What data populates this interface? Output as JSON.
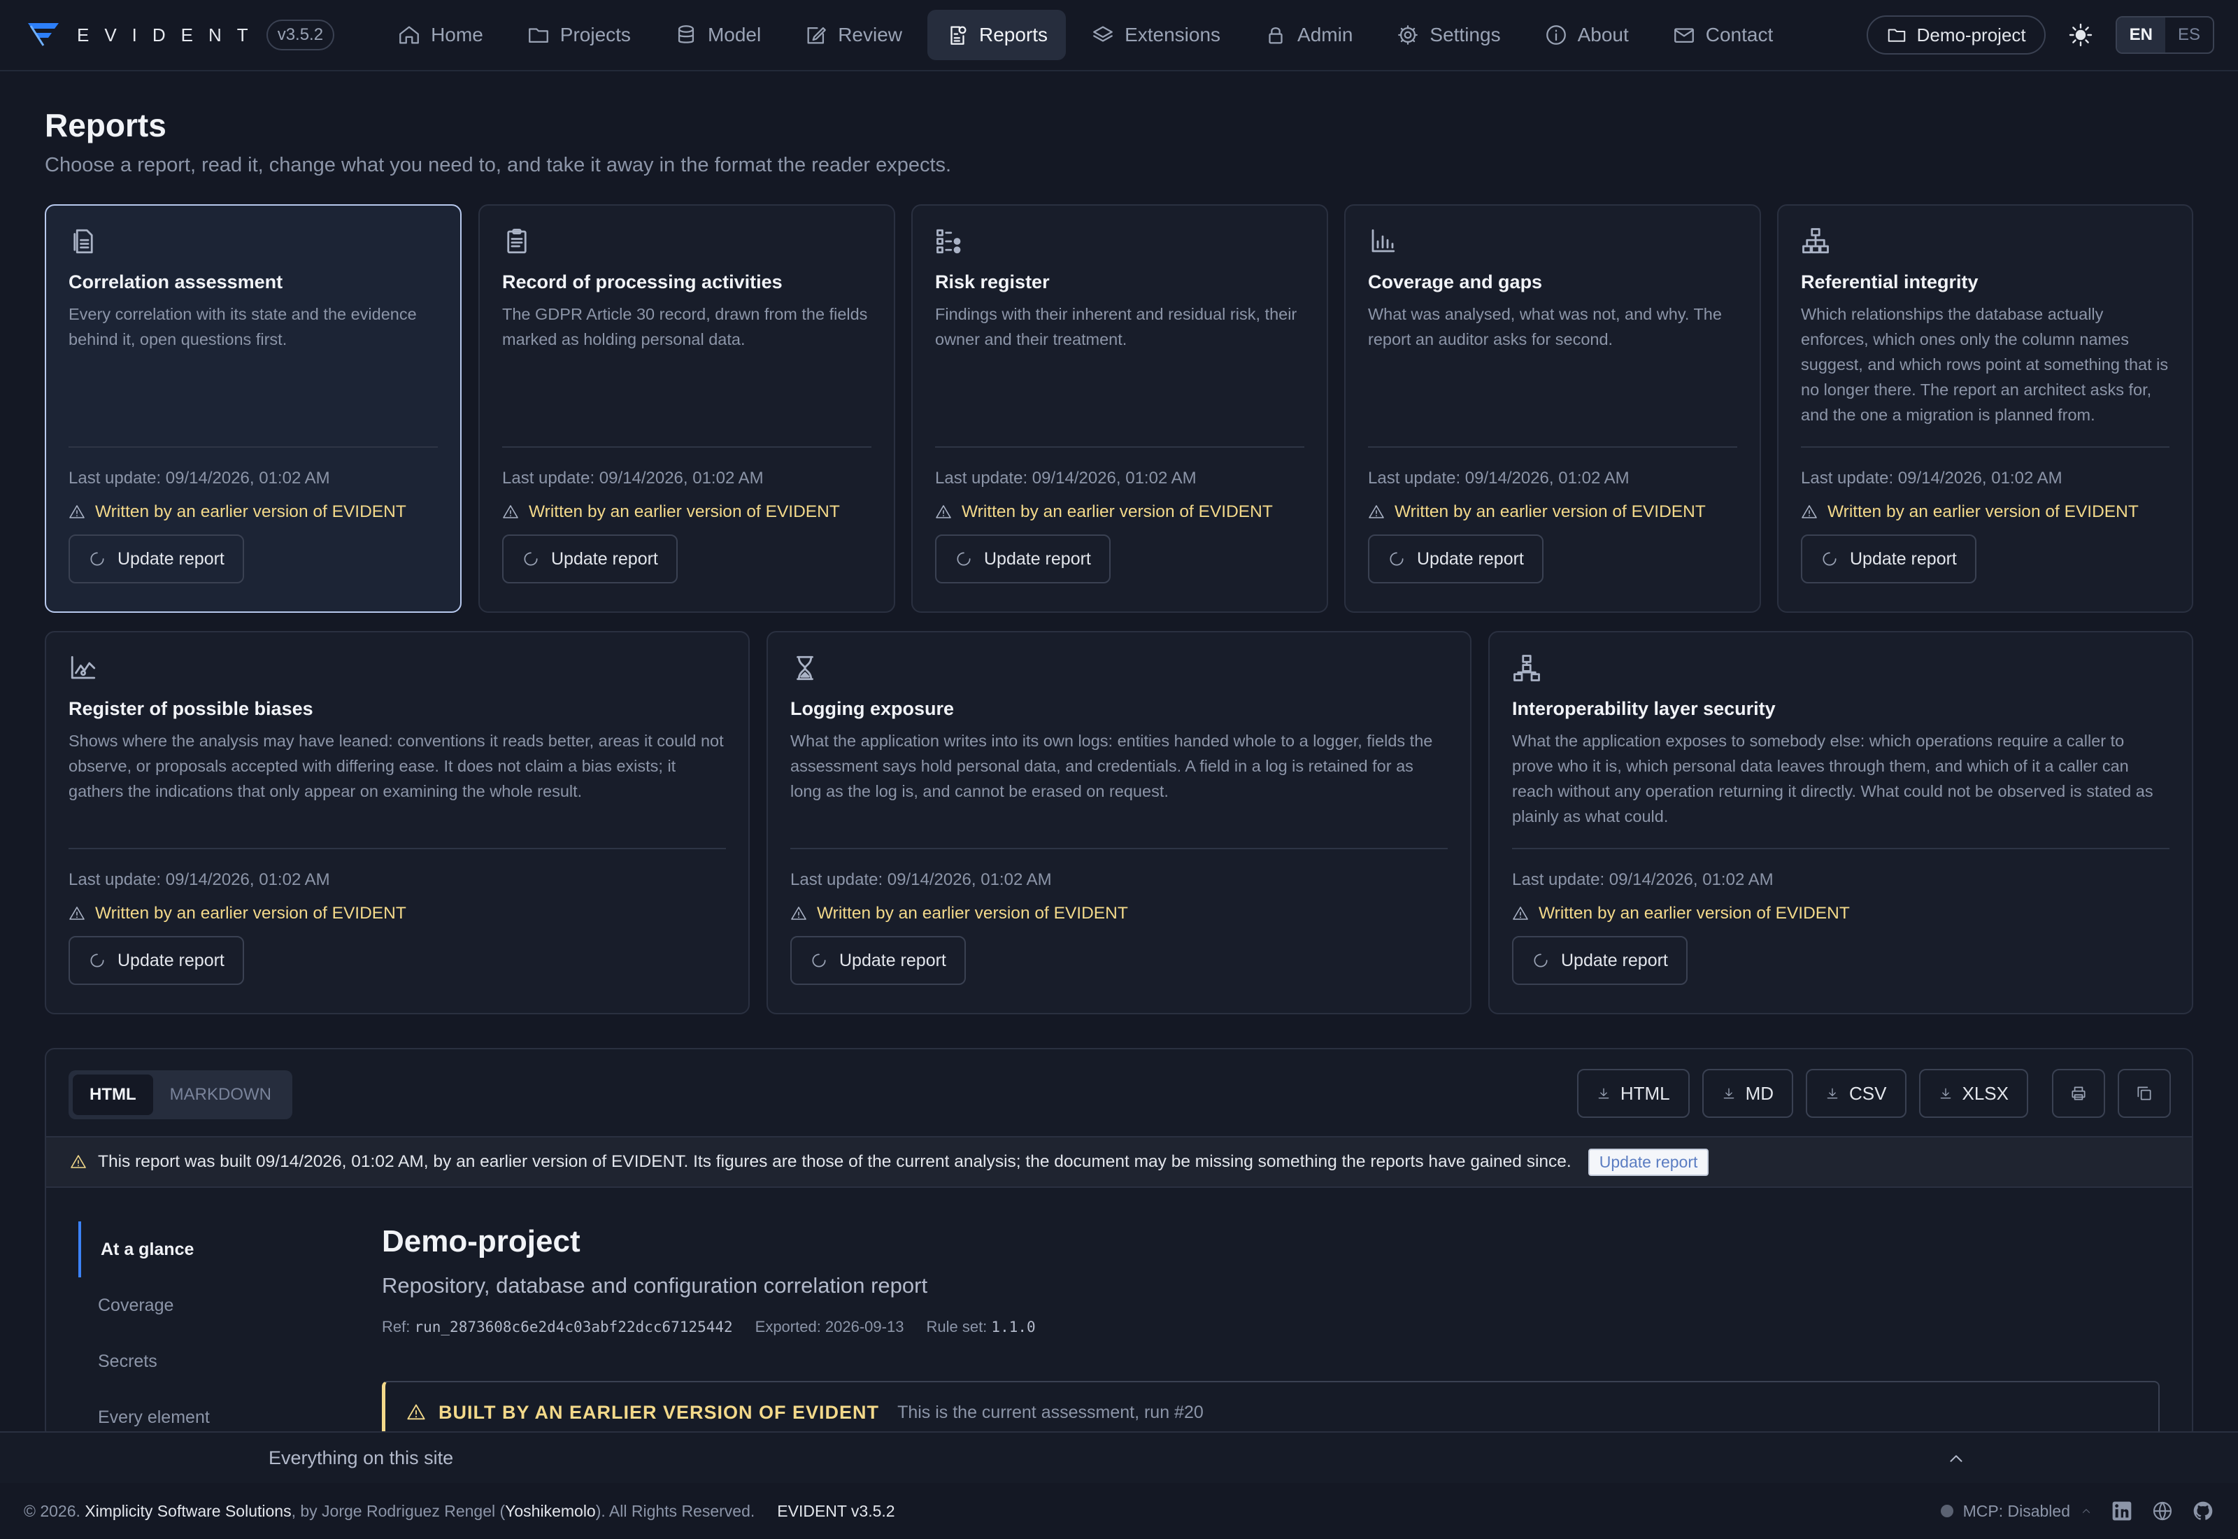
{
  "app": {
    "brand": "EVIDENT",
    "version": "v3.5.2"
  },
  "nav": {
    "items": [
      {
        "label": "Home",
        "icon": "home-icon"
      },
      {
        "label": "Projects",
        "icon": "folder-icon"
      },
      {
        "label": "Model",
        "icon": "database-icon"
      },
      {
        "label": "Review",
        "icon": "edit-icon"
      },
      {
        "label": "Reports",
        "icon": "report-icon"
      },
      {
        "label": "Extensions",
        "icon": "layers-icon"
      },
      {
        "label": "Admin",
        "icon": "lock-icon"
      },
      {
        "label": "Settings",
        "icon": "gear-icon"
      },
      {
        "label": "About",
        "icon": "info-icon"
      },
      {
        "label": "Contact",
        "icon": "mail-icon"
      }
    ],
    "active": "Reports",
    "project": "Demo-project",
    "lang_en": "EN",
    "lang_es": "ES",
    "active_lang": "EN"
  },
  "page": {
    "title": "Reports",
    "subtitle": "Choose a report, read it, change what you need to, and take it away in the format the reader expects."
  },
  "cards": [
    {
      "icon": "document-icon",
      "title": "Correlation assessment",
      "description": "Every correlation with its state and the evidence behind it, open questions first.",
      "updated": "Last update: 09/14/2026, 01:02 AM",
      "warning": "Written by an earlier version of EVIDENT",
      "button": "Update report",
      "selected": true
    },
    {
      "icon": "clipboard-icon",
      "title": "Record of processing activities",
      "description": "The GDPR Article 30 record, drawn from the fields marked as holding personal data.",
      "updated": "Last update: 09/14/2026, 01:02 AM",
      "warning": "Written by an earlier version of EVIDENT",
      "button": "Update report"
    },
    {
      "icon": "risk-matrix-icon",
      "title": "Risk register",
      "description": "Findings with their inherent and residual risk, their owner and their treatment.",
      "updated": "Last update: 09/14/2026, 01:02 AM",
      "warning": "Written by an earlier version of EVIDENT",
      "button": "Update report"
    },
    {
      "icon": "bar-chart-icon",
      "title": "Coverage and gaps",
      "description": "What was analysed, what was not, and why. The report an auditor asks for second.",
      "updated": "Last update: 09/14/2026, 01:02 AM",
      "warning": "Written by an earlier version of EVIDENT",
      "button": "Update report"
    },
    {
      "icon": "hierarchy-icon",
      "title": "Referential integrity",
      "description": "Which relationships the database actually enforces, which ones only the column names suggest, and which rows point at something that is no longer there. The report an architect asks for, and the one a migration is planned from.",
      "updated": "Last update: 09/14/2026, 01:02 AM",
      "warning": "Written by an earlier version of EVIDENT",
      "button": "Update report"
    },
    {
      "icon": "trend-chart-icon",
      "title": "Register of possible biases",
      "description": "Shows where the analysis may have leaned: conventions it reads better, areas it could not observe, or proposals accepted with differing ease. It does not claim a bias exists; it gathers the indications that only appear on examining the whole result.",
      "updated": "Last update: 09/14/2026, 01:02 AM",
      "warning": "Written by an earlier version of EVIDENT",
      "button": "Update report"
    },
    {
      "icon": "hourglass-icon",
      "title": "Logging exposure",
      "description": "What the application writes into its own logs: entities handed whole to a logger, fields the assessment says hold personal data, and credentials. A field in a log is retained for as long as the log is, and cannot be erased on request.",
      "updated": "Last update: 09/14/2026, 01:02 AM",
      "warning": "Written by an earlier version of EVIDENT",
      "button": "Update report"
    },
    {
      "icon": "network-icon",
      "title": "Interoperability layer security",
      "description": "What the application exposes to somebody else: which operations require a caller to prove who it is, which personal data leaves through them, and which of it a caller can reach without any operation returning it directly. What could not be observed is stated as plainly as what could.",
      "updated": "Last update: 09/14/2026, 01:02 AM",
      "warning": "Written by an earlier version of EVIDENT",
      "button": "Update report"
    }
  ],
  "viewer": {
    "format_html": "HTML",
    "format_markdown": "MARKDOWN",
    "active_format": "HTML",
    "downloads": [
      "HTML",
      "MD",
      "CSV",
      "XLSX"
    ],
    "print_icon": "print-icon",
    "copy_icon": "copy-icon",
    "banner": {
      "text": "This report was built 09/14/2026, 01:02 AM, by an earlier version of EVIDENT. Its figures are those of the current analysis; the document may be missing something the reports have gained since.",
      "button": "Update report"
    },
    "toc": [
      "At a glance",
      "Coverage",
      "Secrets",
      "Every element"
    ],
    "toc_active": "At a glance",
    "doc": {
      "title": "Demo-project",
      "subtitle": "Repository, database and configuration correlation report",
      "ref_label": "Ref:",
      "ref_value": "run_2873608c6e2d4c03abf22dcc67125442",
      "exported": "Exported: 2026-09-13",
      "ruleset_label": "Rule set:",
      "ruleset_value": "1.1.0",
      "callout_title": "BUILT BY AN EARLIER VERSION OF EVIDENT",
      "callout_text": "This is the current assessment, run #20"
    }
  },
  "drawer": {
    "label": "Everything on this site"
  },
  "footer": {
    "copyright": "© 2026.",
    "company": "Ximplicity Software Solutions",
    "by": ", by Jorge Rodriguez Rengel (",
    "handle": "Yoshikemolo",
    "rights": "). All Rights Reserved.",
    "version": "EVIDENT v3.5.2",
    "mcp": "MCP: Disabled",
    "social": [
      "linkedin-icon",
      "globe-icon",
      "github-icon"
    ]
  },
  "colors": {
    "background": "#141824",
    "card": "#181d2a",
    "accent": "#3b82f6",
    "warning": "#f3d98a",
    "active_nav": "#262d3d"
  }
}
